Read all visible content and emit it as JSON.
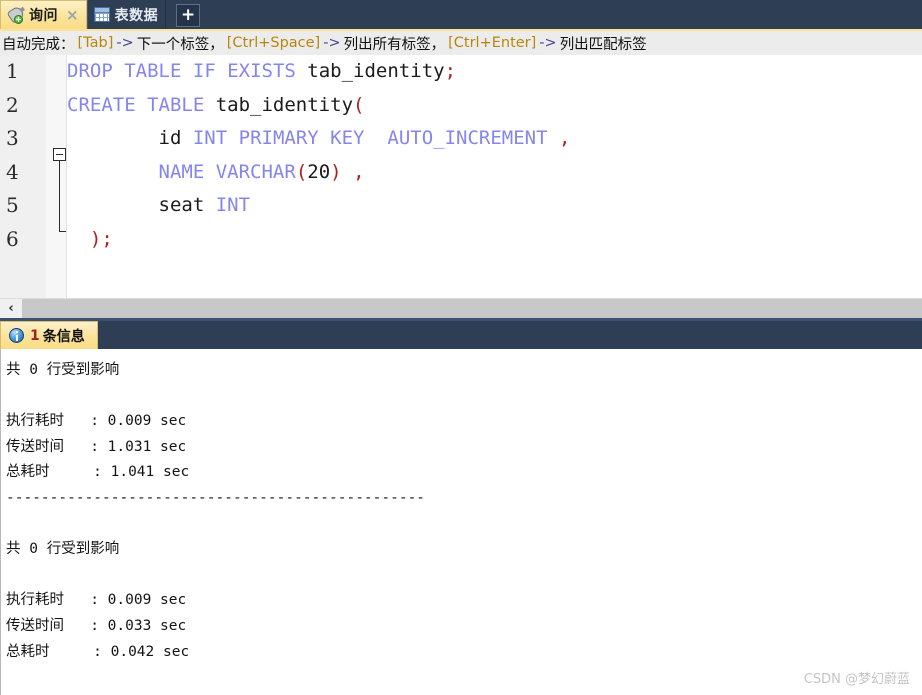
{
  "tabs": [
    {
      "label": "询问",
      "icon": "query-plug-icon",
      "active": true,
      "close": "×"
    },
    {
      "label": "表数据",
      "icon": "table-grid-icon",
      "active": false
    }
  ],
  "new_tab_button": {
    "label": "+",
    "icon": "plus-icon"
  },
  "hint_bar": {
    "prefix": "自动完成：",
    "items": [
      {
        "key": "[Tab]",
        "arrow": "->",
        "text": "下一个标签，"
      },
      {
        "key": "[Ctrl+Space]",
        "arrow": "->",
        "text": "列出所有标签，"
      },
      {
        "key": "[Ctrl+Enter]",
        "arrow": "->",
        "text": "列出匹配标签"
      }
    ]
  },
  "editor": {
    "line_numbers": [
      "1",
      "2",
      "3",
      "4",
      "5",
      "6"
    ],
    "fold_marker": "collapse-minus",
    "lines": [
      {
        "n": 1,
        "tokens": [
          {
            "t": "DROP",
            "c": "kw"
          },
          {
            "t": " ",
            "c": "id"
          },
          {
            "t": "TABLE",
            "c": "kw"
          },
          {
            "t": " ",
            "c": "id"
          },
          {
            "t": "IF",
            "c": "kw"
          },
          {
            "t": " ",
            "c": "id"
          },
          {
            "t": "EXISTS",
            "c": "kw"
          },
          {
            "t": " tab_identity",
            "c": "id"
          },
          {
            "t": ";",
            "c": "pn"
          }
        ]
      },
      {
        "n": 2,
        "tokens": [
          {
            "t": "CREATE",
            "c": "kw"
          },
          {
            "t": " ",
            "c": "id"
          },
          {
            "t": "TABLE",
            "c": "kw"
          },
          {
            "t": " tab_identity",
            "c": "id"
          },
          {
            "t": "(",
            "c": "pn"
          }
        ]
      },
      {
        "n": 3,
        "tokens": [
          {
            "t": "        id ",
            "c": "id"
          },
          {
            "t": "INT",
            "c": "kw"
          },
          {
            "t": " ",
            "c": "id"
          },
          {
            "t": "PRIMARY",
            "c": "kw"
          },
          {
            "t": " ",
            "c": "id"
          },
          {
            "t": "KEY",
            "c": "kw"
          },
          {
            "t": "  ",
            "c": "id"
          },
          {
            "t": "AUTO_INCREMENT",
            "c": "kw"
          },
          {
            "t": " ",
            "c": "id"
          },
          {
            "t": ",",
            "c": "pn"
          }
        ]
      },
      {
        "n": 4,
        "tokens": [
          {
            "t": "        ",
            "c": "id"
          },
          {
            "t": "NAME",
            "c": "kw"
          },
          {
            "t": " ",
            "c": "id"
          },
          {
            "t": "VARCHAR",
            "c": "kw"
          },
          {
            "t": "(",
            "c": "pn"
          },
          {
            "t": "20",
            "c": "id"
          },
          {
            "t": ")",
            "c": "pn"
          },
          {
            "t": " ",
            "c": "id"
          },
          {
            "t": ",",
            "c": "pn"
          }
        ]
      },
      {
        "n": 5,
        "tokens": [
          {
            "t": "        seat ",
            "c": "id"
          },
          {
            "t": "INT",
            "c": "kw"
          }
        ]
      },
      {
        "n": 6,
        "tokens": [
          {
            "t": "  ",
            "c": "id"
          },
          {
            "t": ")",
            "c": "pn"
          },
          {
            "t": ";",
            "c": "pn"
          }
        ]
      }
    ]
  },
  "h_scrollbar": {
    "left_button": "‹"
  },
  "result_tab": {
    "icon": "info-icon",
    "count": "1",
    "label": "条信息"
  },
  "output": {
    "text": "共 0 行受到影响\n\n执行耗时   : 0.009 sec\n传送时间   : 1.031 sec\n总耗时     : 1.041 sec\n------------------------------------------------\n\n共 0 行受到影响\n\n执行耗时   : 0.009 sec\n传送时间   : 0.033 sec\n总耗时     : 0.042 sec",
    "blocks": [
      {
        "affected": "共 0 行受到影响",
        "exec_label": "执行耗时",
        "exec_value": "0.009 sec",
        "transfer_label": "传送时间",
        "transfer_value": "1.031 sec",
        "total_label": "总耗时",
        "total_value": "1.041 sec"
      },
      {
        "affected": "共 0 行受到影响",
        "exec_label": "执行耗时",
        "exec_value": "0.009 sec",
        "transfer_label": "传送时间",
        "transfer_value": "0.033 sec",
        "total_label": "总耗时",
        "total_value": "0.042 sec"
      }
    ]
  },
  "watermark": "CSDN @梦幻蔚蓝",
  "colors": {
    "chrome": "#2d3e55",
    "active_tab": "#fbe49a",
    "keyword": "#8585f0",
    "punct": "#b02020",
    "count_red": "#a32020"
  }
}
